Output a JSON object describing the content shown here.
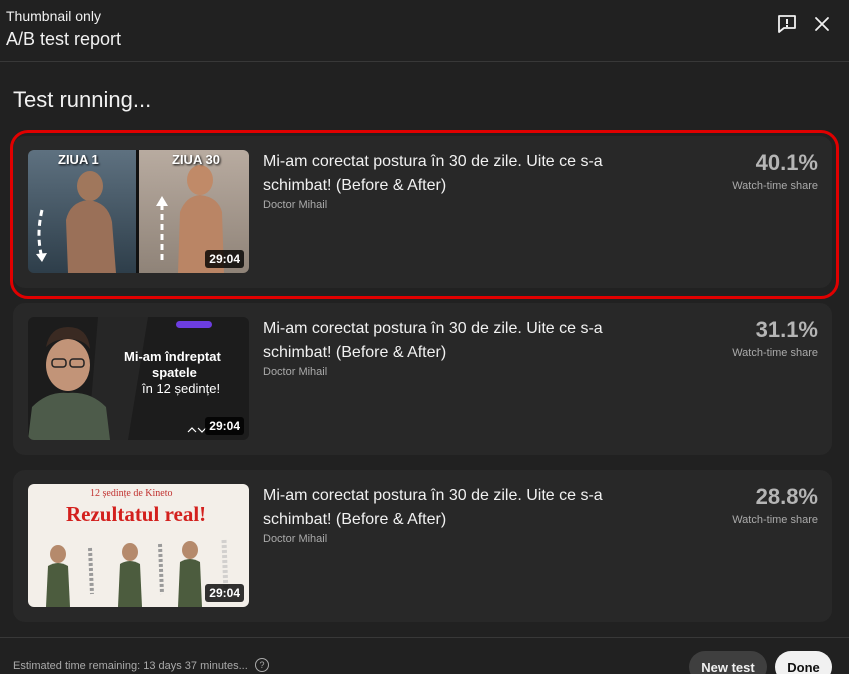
{
  "header": {
    "subtitle": "Thumbnail only",
    "title": "A/B test report"
  },
  "status": "Test running...",
  "cards": [
    {
      "title": "Mi-am corectat postura în 30 de zile. Uite ce s-a schimbat! (Before & After)",
      "channel": "Doctor Mihail",
      "duration": "29:04",
      "percent": "40.1%",
      "metric_label": "Watch-time share",
      "thumb": {
        "left_label": "ZIUA 1",
        "right_label": "ZIUA 30"
      }
    },
    {
      "title": "Mi-am corectat postura în 30 de zile. Uite ce s-a schimbat! (Before & After)",
      "channel": "Doctor Mihail",
      "duration": "29:04",
      "percent": "31.1%",
      "metric_label": "Watch-time share",
      "thumb": {
        "line1": "Mi-am îndreptat",
        "line2": "spatele",
        "line3": "în 12 ședințe!"
      }
    },
    {
      "title": "Mi-am corectat postura în 30 de zile. Uite ce s-a schimbat! (Before & After)",
      "channel": "Doctor Mihail",
      "duration": "29:04",
      "percent": "28.8%",
      "metric_label": "Watch-time share",
      "thumb": {
        "top": "12 ședințe de Kineto",
        "headline": "Rezultatul real!"
      }
    }
  ],
  "footer": {
    "estimate": "Estimated time remaining: 13 days 37 minutes...",
    "new_test": "New test",
    "done": "Done"
  },
  "colors": {
    "highlight": "#e00000",
    "background": "#212121",
    "card": "#282828"
  }
}
